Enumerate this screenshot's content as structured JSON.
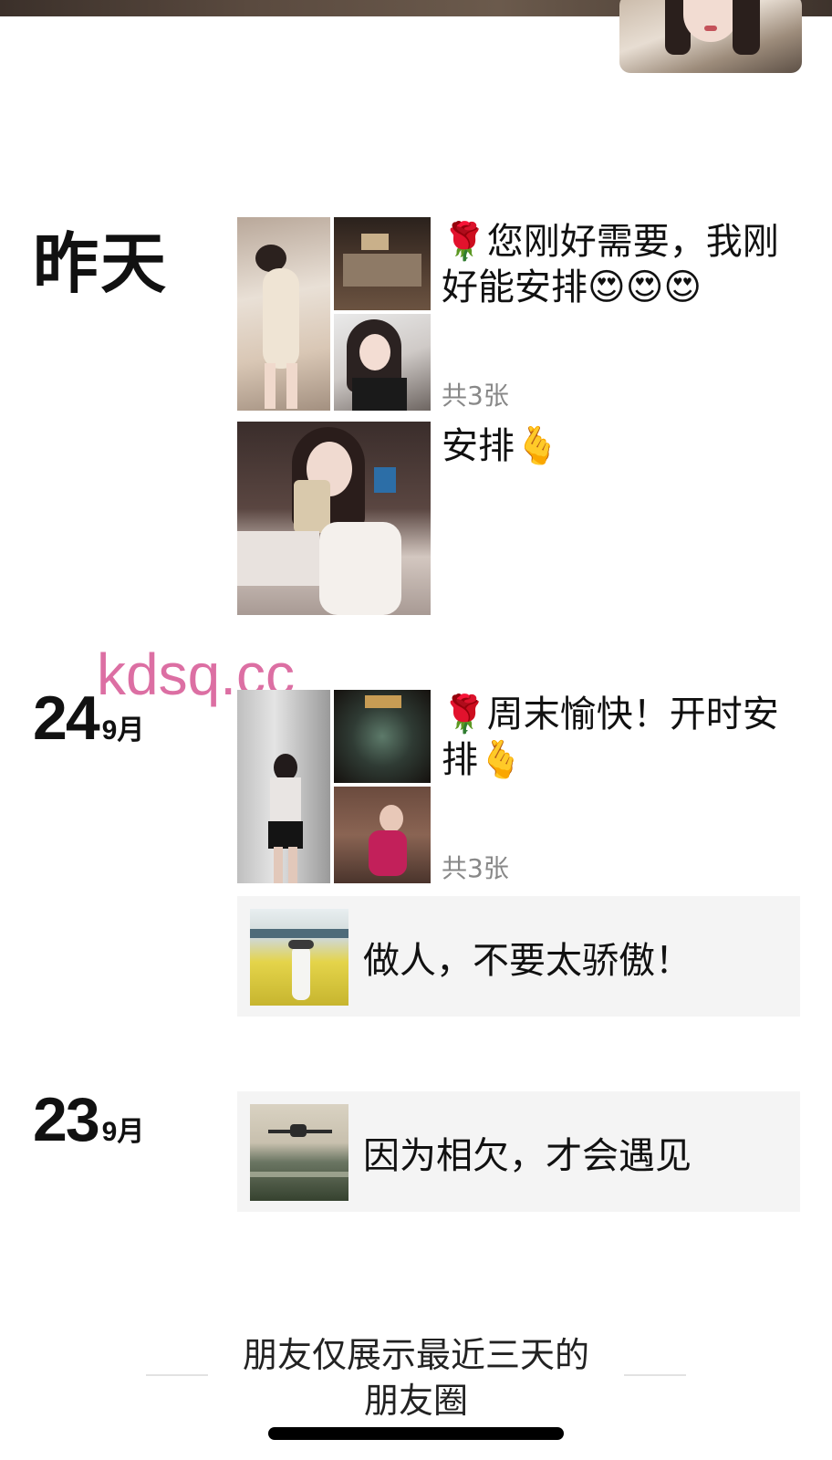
{
  "moments": [
    {
      "date_word": "昨天",
      "posts": [
        {
          "text": "🌹您刚好需要，我刚好能安排😍😍😍",
          "photo_count": "共3张"
        },
        {
          "text": "安排🫰"
        }
      ]
    },
    {
      "date_day": "24",
      "date_month": "9月",
      "posts": [
        {
          "text": "🌹周末愉快！开时安排🫰",
          "photo_count": "共3张"
        },
        {
          "share_text": "做人，不要太骄傲！"
        }
      ]
    },
    {
      "date_day": "23",
      "date_month": "9月",
      "posts": [
        {
          "share_text": "因为相欠，才会遇见"
        }
      ]
    }
  ],
  "watermark": "kdsq.cc",
  "footer": {
    "line1": "朋友仅展示最近三天的",
    "line2": "朋友圈"
  },
  "colors": {
    "background": "#ffffff",
    "share_box": "#f4f4f4",
    "count_text": "#888888",
    "watermark": "#d9609a"
  }
}
